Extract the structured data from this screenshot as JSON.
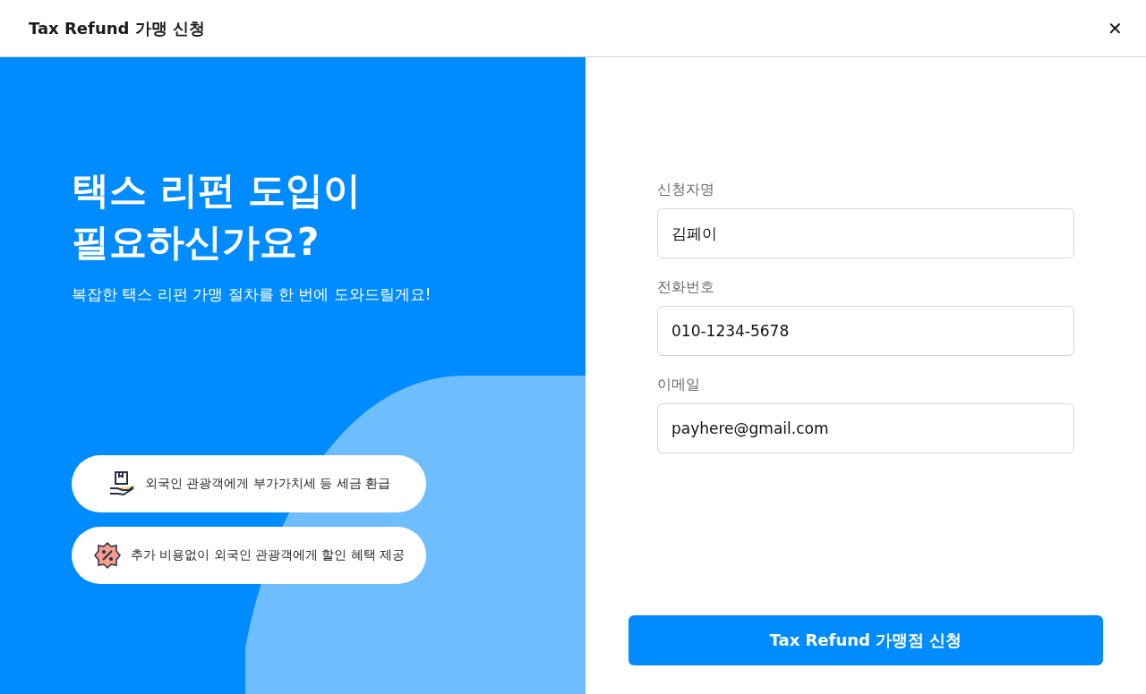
{
  "window": {
    "title": "Tax Refund 가맹 신청",
    "close": "✕"
  },
  "hero": {
    "title_lines": [
      "택스 리펀 도입이",
      "필요하신가요?"
    ],
    "subtitle": "복잡한 택스 리펀 가맹 절차를 한 번에 도와드릴게요!",
    "features": [
      {
        "kind": "refund",
        "text": "외국인 관광객에게 부가가치세 등 세금 환급"
      },
      {
        "kind": "discount",
        "text": "추가 비용없이 외국인 관광객에게 할인 혜택 제공"
      }
    ]
  },
  "form": {
    "fields": [
      {
        "label": "신청자명",
        "value": "김페이"
      },
      {
        "label": "전화번호",
        "value": "010-1234-5678"
      },
      {
        "label": "이메일",
        "value": "payhere@gmail.com"
      }
    ],
    "submit": "Tax Refund 가맹점 신청"
  }
}
